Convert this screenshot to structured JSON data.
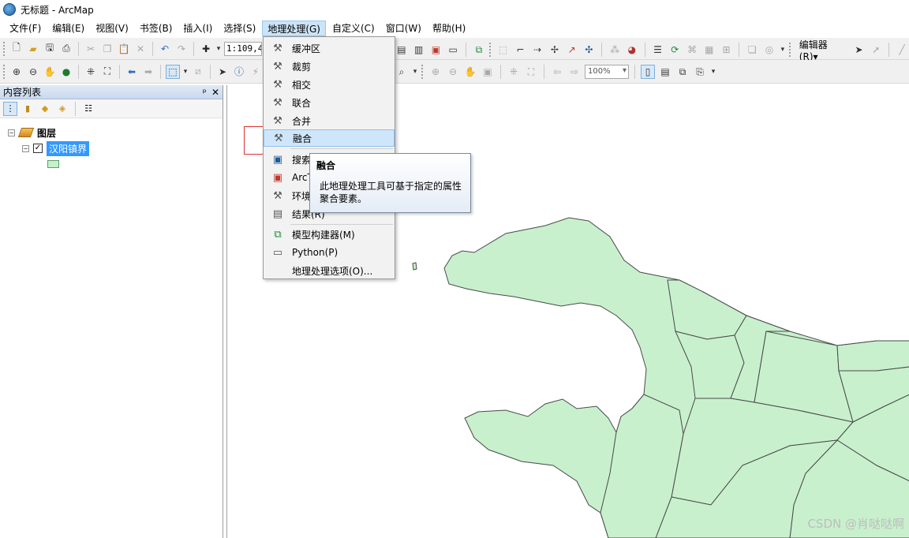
{
  "window": {
    "title": "无标题 - ArcMap"
  },
  "menubar": {
    "items": [
      "文件(F)",
      "编辑(E)",
      "视图(V)",
      "书签(B)",
      "插入(I)",
      "选择(S)",
      "地理处理(G)",
      "自定义(C)",
      "窗口(W)",
      "帮助(H)"
    ],
    "active_index": 6
  },
  "toolbar": {
    "scale_value": "1:109,4",
    "zoom_value": "100%",
    "editor_label": "编辑器(R)▾"
  },
  "toc": {
    "title": "内容列表",
    "pin": "ᵖ",
    "close": "✕",
    "root_layer": "图层",
    "layer_name": "汉阳镇界",
    "layer_checked": "✓",
    "collapse": "−"
  },
  "geoprocessing_menu": {
    "items": [
      {
        "label": "缓冲区",
        "icon": "hammer-icon"
      },
      {
        "label": "裁剪",
        "icon": "hammer-icon"
      },
      {
        "label": "相交",
        "icon": "hammer-icon"
      },
      {
        "label": "联合",
        "icon": "hammer-icon"
      },
      {
        "label": "合并",
        "icon": "hammer-icon"
      },
      {
        "label": "融合",
        "icon": "hammer-icon",
        "highlighted": true
      },
      {
        "label": "搜索",
        "icon": "search-window-icon"
      },
      {
        "label": "ArcT",
        "icon": "toolbox-icon"
      },
      {
        "label": "环境",
        "icon": "tools-icon"
      },
      {
        "label": "结果(R)",
        "icon": "results-icon"
      },
      {
        "label": "模型构建器(M)",
        "icon": "model-builder-icon"
      },
      {
        "label": "Python(P)",
        "icon": "python-window-icon"
      },
      {
        "label": "地理处理选项(O)...",
        "icon": ""
      }
    ]
  },
  "tooltip": {
    "title": "融合",
    "body": "此地理处理工具可基于指定的属性聚合要素。"
  },
  "watermark": "CSDN @肖哒哒啊",
  "colors": {
    "polygon_fill": "#c8f0cd",
    "polygon_stroke": "#4a4a4a",
    "selection": "#3399ff",
    "highlight_frame": "#e03030"
  }
}
